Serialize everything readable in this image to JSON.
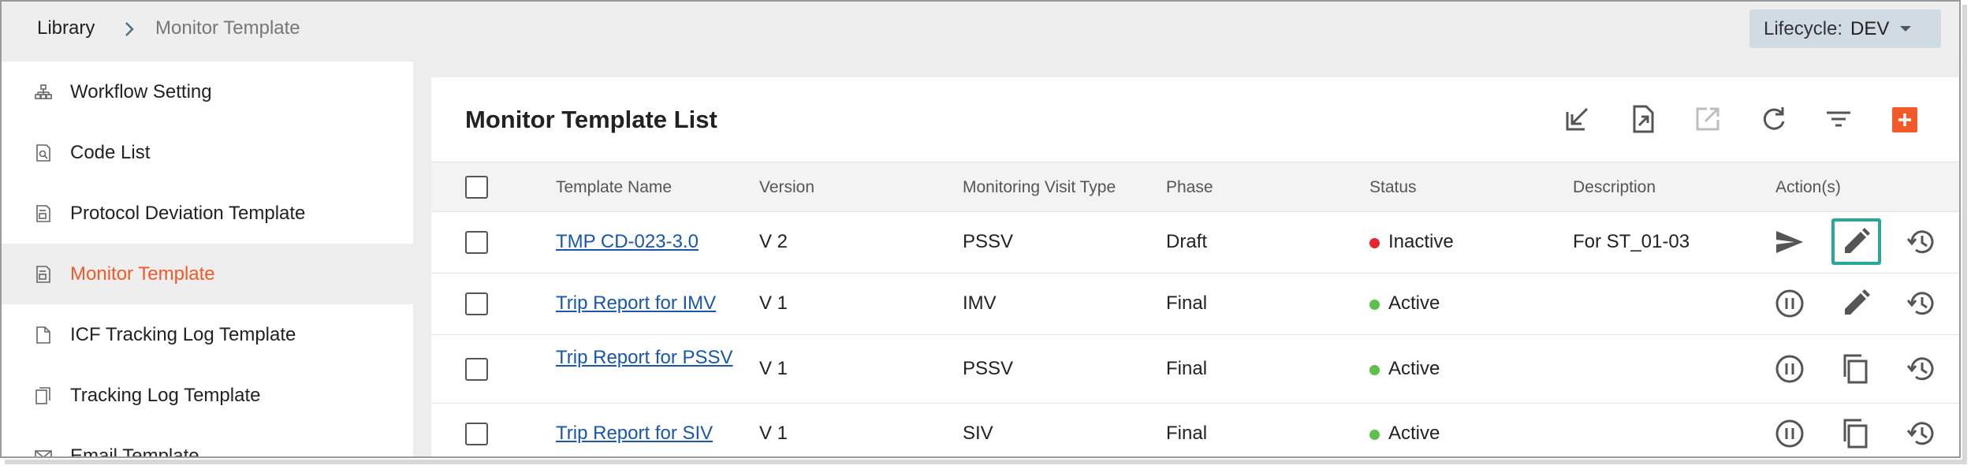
{
  "breadcrumb": {
    "root": "Library",
    "current": "Monitor Template"
  },
  "lifecycle": {
    "label": "Lifecycle:",
    "value": "DEV"
  },
  "sidebar": {
    "items": [
      {
        "label": "Workflow Setting",
        "icon": "workflow-icon"
      },
      {
        "label": "Code List",
        "icon": "code-list-icon"
      },
      {
        "label": "Protocol Deviation Template",
        "icon": "template-icon"
      },
      {
        "label": "Monitor Template",
        "icon": "template-icon",
        "active": true
      },
      {
        "label": "ICF Tracking Log Template",
        "icon": "document-icon"
      },
      {
        "label": "Tracking Log Template",
        "icon": "copy-document-icon"
      },
      {
        "label": "Email Template",
        "icon": "mail-icon"
      }
    ]
  },
  "main": {
    "title": "Monitor Template List",
    "toolbar": [
      "import-icon",
      "export-icon",
      "open-external-icon",
      "refresh-icon",
      "filter-icon",
      "add-icon"
    ],
    "columns": [
      "Template Name",
      "Version",
      "Monitoring Visit Type",
      "Phase",
      "Status",
      "Description",
      "Action(s)"
    ],
    "rows": [
      {
        "name": "TMP CD-023-3.0",
        "version": "V 2",
        "visit_type": "PSSV",
        "phase": "Draft",
        "status": "Inactive",
        "description": "For ST_01-03",
        "actions": [
          "send-icon",
          "edit-icon",
          "history-icon"
        ]
      },
      {
        "name": "Trip Report for IMV",
        "version": "V 1",
        "visit_type": "IMV",
        "phase": "Final",
        "status": "Active",
        "description": "",
        "actions": [
          "pause-icon",
          "edit-icon",
          "history-icon"
        ]
      },
      {
        "name": "Trip Report for PSSV",
        "version": "V 1",
        "visit_type": "PSSV",
        "phase": "Final",
        "status": "Active",
        "description": "",
        "actions": [
          "pause-icon",
          "copy-icon",
          "history-icon"
        ]
      },
      {
        "name": "Trip Report for SIV",
        "version": "V 1",
        "visit_type": "SIV",
        "phase": "Final",
        "status": "Active",
        "description": "",
        "actions": [
          "pause-icon",
          "copy-icon",
          "history-icon"
        ]
      }
    ]
  },
  "colors": {
    "accent": "#f05a28",
    "link": "#1a57a8",
    "active_status": "#5cc14a",
    "inactive_status": "#e5242b",
    "highlight": "#29a899"
  }
}
